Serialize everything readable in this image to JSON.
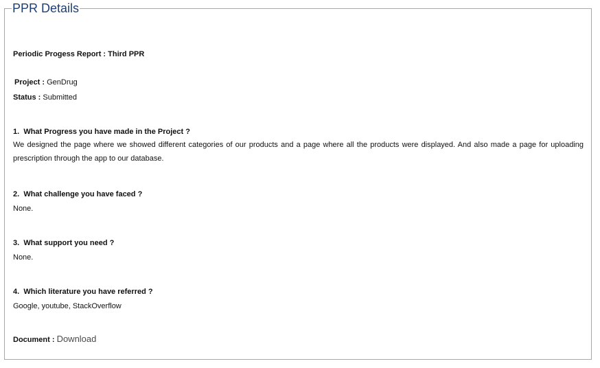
{
  "panel": {
    "legend": "PPR Details"
  },
  "report": {
    "label": "Periodic Progess Report :",
    "value": "Third PPR"
  },
  "project": {
    "label": "Project :",
    "value": "GenDrug"
  },
  "status": {
    "label": "Status :",
    "value": "Submitted"
  },
  "questions": [
    {
      "number": "1.",
      "question": "What Progress you have made in the Project ?",
      "answer": "We designed the page where we showed different categories of our products and a page where all the products were displayed. And also made a page for uploading prescription through the app to our database."
    },
    {
      "number": "2.",
      "question": "What challenge you have faced ?",
      "answer": "None."
    },
    {
      "number": "3.",
      "question": "What support you need ?",
      "answer": "None."
    },
    {
      "number": "4.",
      "question": "Which literature you have referred ?",
      "answer": "Google, youtube, StackOverflow"
    }
  ],
  "document": {
    "label": "Document :",
    "link_text": "Download"
  }
}
